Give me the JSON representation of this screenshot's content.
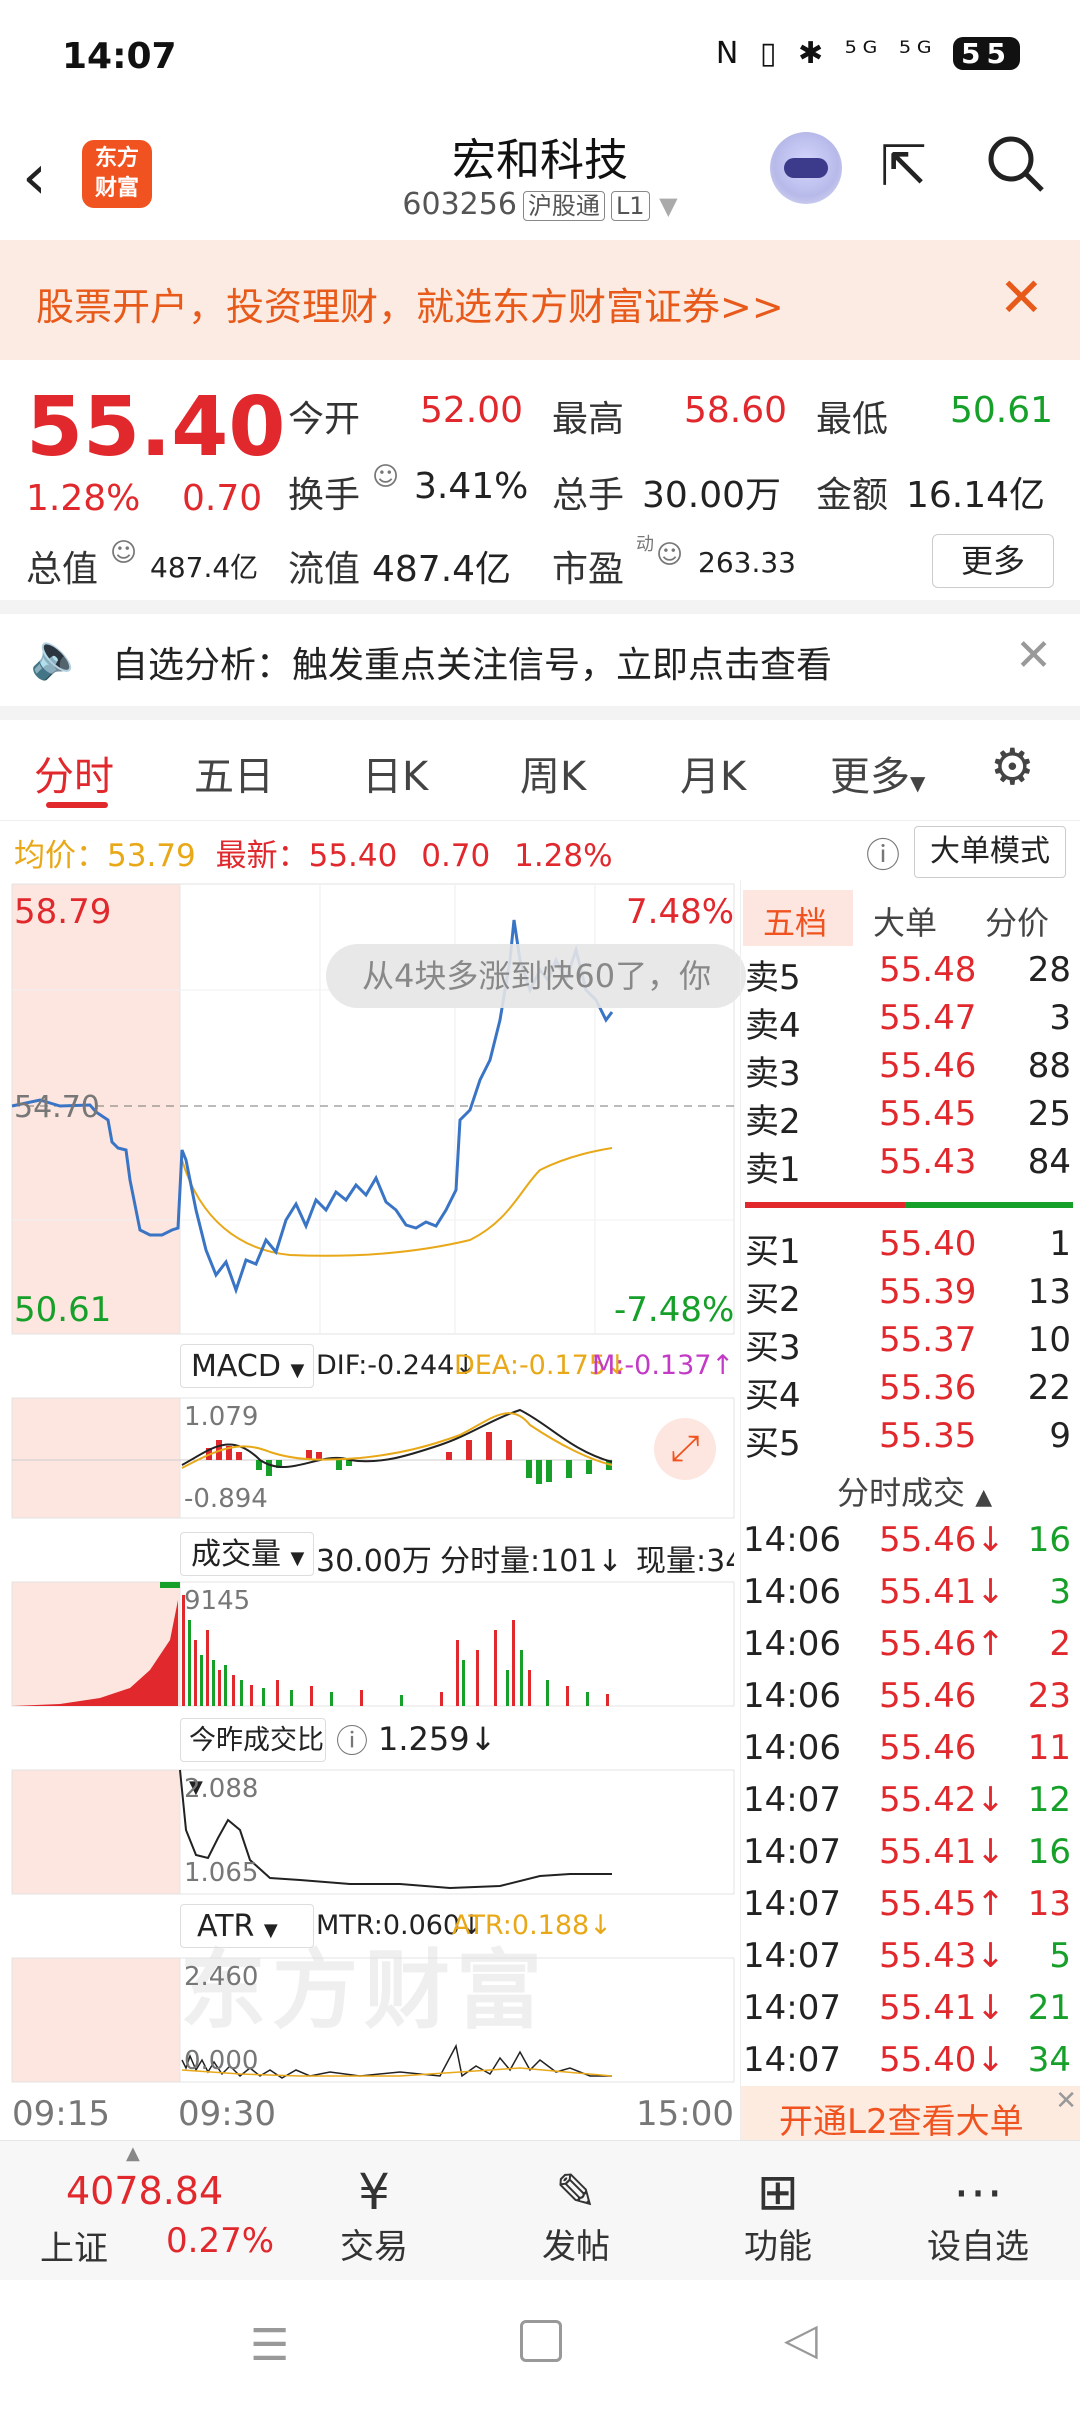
{
  "status": {
    "time": "14:07",
    "battery": "55",
    "icons": "N ▯ ✱ ⁵ᴳ ⁵ᴳ"
  },
  "header": {
    "title": "宏和科技",
    "code": "603256",
    "tag1": "沪股通",
    "tag2": "L1",
    "logo_line1": "东方",
    "logo_line2": "财富"
  },
  "banner": {
    "text": "股票开户，投资理财，就选东方财富证券>>"
  },
  "quote": {
    "price": "55.40",
    "pct": "1.28%",
    "change": "0.70",
    "open_label": "今开",
    "open": "52.00",
    "high_label": "最高",
    "high": "58.60",
    "low_label": "最低",
    "low": "50.61",
    "turnover_label": "换手",
    "turnover": "3.41%",
    "volume_label": "总手",
    "volume": "30.00万",
    "amount_label": "金额",
    "amount": "16.14亿",
    "mcap_label": "总值",
    "mcap": "487.4亿",
    "float_label": "流值",
    "float": "487.4亿",
    "pe_label": "市盈",
    "pe_sup": "动",
    "pe": "263.33",
    "more": "更多"
  },
  "notice": {
    "text": "自选分析：触发重点关注信号，立即点击查看"
  },
  "tabs": [
    "分时",
    "五日",
    "日K",
    "周K",
    "月K",
    "更多"
  ],
  "avgline": {
    "avg_label": "均价：",
    "avg": "53.79",
    "latest_label": "最新：",
    "latest": "55.40",
    "chg": "0.70",
    "pct": "1.28%",
    "mode": "大单模式"
  },
  "chart": {
    "top_price": "58.79",
    "bottom_price": "50.61",
    "mid_price": "54.70",
    "top_pct": "7.48%",
    "bottom_pct": "-7.48%",
    "tooltip": "从4块多涨到快60了，你",
    "watermark": "东方财富",
    "t_start": "09:15",
    "t_open": "09:30",
    "t_end": "15:00",
    "macd_label": "MACD",
    "dif": "DIF:-0.244↓",
    "dea": "DEA:-0.175↓",
    "m": "M:-0.137↑",
    "macd_top": "1.079",
    "macd_bot": "-0.894",
    "vol_label": "成交量",
    "vol_total": "30.00万",
    "vol_min": "分时量:101↓",
    "vol_now": "现量:34",
    "vol_top": "9145",
    "ratio_label": "今昨成交比",
    "ratio": "1.259↓",
    "ratio_top": "2.088",
    "ratio_bot": "1.065",
    "atr_label": "ATR",
    "mtr": "MTR:0.060↓",
    "atr": "ATR:0.188↓",
    "atr_top": "2.460",
    "atr_bot": "0.000"
  },
  "depth": {
    "tabs": [
      "五档",
      "大单",
      "分价"
    ],
    "asks": [
      [
        "卖5",
        "55.48",
        "28"
      ],
      [
        "卖4",
        "55.47",
        "3"
      ],
      [
        "卖3",
        "55.46",
        "88"
      ],
      [
        "卖2",
        "55.45",
        "25"
      ],
      [
        "卖1",
        "55.43",
        "84"
      ]
    ],
    "bids": [
      [
        "买1",
        "55.40",
        "1"
      ],
      [
        "买2",
        "55.39",
        "13"
      ],
      [
        "买3",
        "55.37",
        "10"
      ],
      [
        "买4",
        "55.36",
        "22"
      ],
      [
        "买5",
        "55.35",
        "9"
      ]
    ],
    "ticks_title": "分时成交",
    "ticks": [
      [
        "14:06",
        "55.46↓",
        "16",
        "g"
      ],
      [
        "14:06",
        "55.41↓",
        "3",
        "g"
      ],
      [
        "14:06",
        "55.46↑",
        "2",
        "r"
      ],
      [
        "14:06",
        "55.46",
        "23",
        "r"
      ],
      [
        "14:06",
        "55.46",
        "11",
        "r"
      ],
      [
        "14:07",
        "55.42↓",
        "12",
        "g"
      ],
      [
        "14:07",
        "55.41↓",
        "16",
        "g"
      ],
      [
        "14:07",
        "55.45↑",
        "13",
        "r"
      ],
      [
        "14:07",
        "55.43↓",
        "5",
        "g"
      ],
      [
        "14:07",
        "55.41↓",
        "21",
        "g"
      ],
      [
        "14:07",
        "55.40↓",
        "34",
        "g"
      ]
    ],
    "l2": "开通L2查看大单"
  },
  "bottom": {
    "index_value": "4078.84",
    "index_name": "上证",
    "index_pct": "0.27%",
    "items": [
      [
        "交易",
        "¥"
      ],
      [
        "发帖",
        "✎"
      ],
      [
        "功能",
        "⊞"
      ],
      [
        "设自选",
        "⋯"
      ]
    ]
  }
}
